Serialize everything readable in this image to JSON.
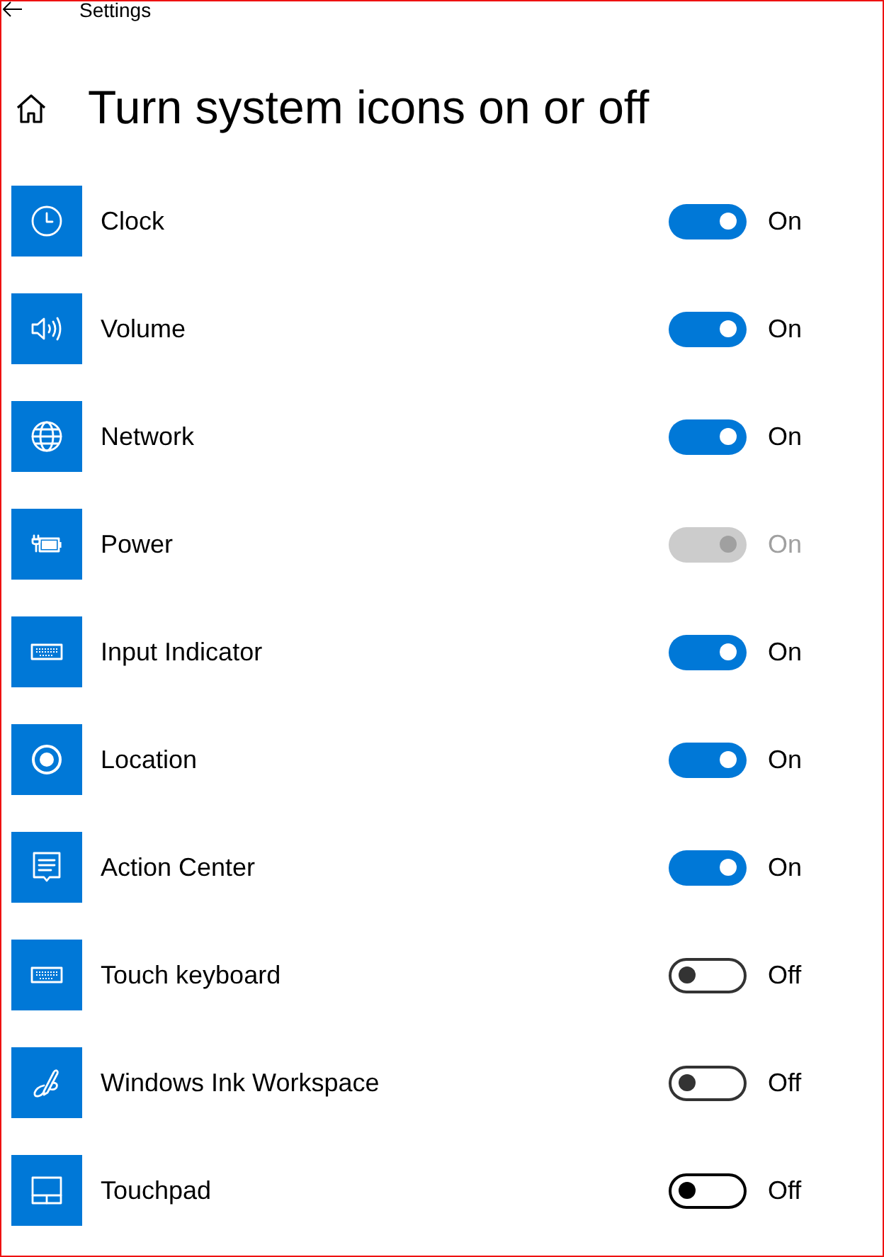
{
  "window": {
    "title": "Settings"
  },
  "page": {
    "title": "Turn system icons on or off"
  },
  "items": [
    {
      "kind": "clock",
      "name": "Clock",
      "on": true,
      "disabled": false,
      "focused": false,
      "state_label": "On"
    },
    {
      "kind": "speaker",
      "name": "Volume",
      "on": true,
      "disabled": false,
      "focused": false,
      "state_label": "On"
    },
    {
      "kind": "globe",
      "name": "Network",
      "on": true,
      "disabled": false,
      "focused": false,
      "state_label": "On"
    },
    {
      "kind": "battery",
      "name": "Power",
      "on": true,
      "disabled": true,
      "focused": false,
      "state_label": "On"
    },
    {
      "kind": "keyboard",
      "name": "Input Indicator",
      "on": true,
      "disabled": false,
      "focused": false,
      "state_label": "On"
    },
    {
      "kind": "location",
      "name": "Location",
      "on": true,
      "disabled": false,
      "focused": false,
      "state_label": "On"
    },
    {
      "kind": "message",
      "name": "Action Center",
      "on": true,
      "disabled": false,
      "focused": false,
      "state_label": "On"
    },
    {
      "kind": "keyboard",
      "name": "Touch keyboard",
      "on": false,
      "disabled": false,
      "focused": false,
      "state_label": "Off"
    },
    {
      "kind": "pen",
      "name": "Windows Ink Workspace",
      "on": false,
      "disabled": false,
      "focused": false,
      "state_label": "Off"
    },
    {
      "kind": "touchpad",
      "name": "Touchpad",
      "on": false,
      "disabled": false,
      "focused": true,
      "state_label": "Off"
    }
  ]
}
